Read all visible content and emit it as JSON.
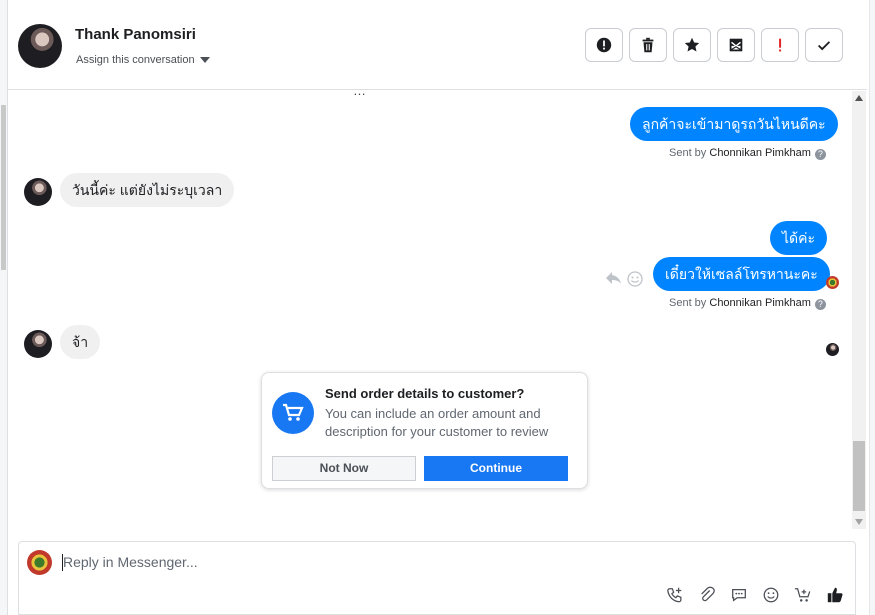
{
  "header": {
    "contact_name": "Thank Panomsiri",
    "assign_label": "Assign this conversation",
    "actions": [
      {
        "name": "mark-spam-button",
        "icon": "alert-circle-icon"
      },
      {
        "name": "delete-button",
        "icon": "trash-icon"
      },
      {
        "name": "star-button",
        "icon": "star-icon"
      },
      {
        "name": "mark-unread-button",
        "icon": "envelope-icon"
      },
      {
        "name": "follow-up-button",
        "icon": "exclamation-icon"
      },
      {
        "name": "mark-done-button",
        "icon": "checkmark-icon"
      }
    ]
  },
  "messages": [
    {
      "direction": "out",
      "text": "ลูกค้าจะเข้ามาดูรถวันไหนดีคะ",
      "sent_by_prefix": "Sent by",
      "sent_by_name": "Chonnikan Pimkham"
    },
    {
      "direction": "in",
      "text": "วันนี้ค่ะ แต่ยังไม่ระบุเวลา"
    },
    {
      "direction": "out",
      "text": "ได้ค่ะ"
    },
    {
      "direction": "out",
      "text": "เดี๋ยวให้เซลล์โทรหานะคะ",
      "sent_by_prefix": "Sent by",
      "sent_by_name": "Chonnikan Pimkham"
    },
    {
      "direction": "in",
      "text": "จ้า"
    }
  ],
  "order_prompt": {
    "title": "Send order details to customer?",
    "description": "You can include an order amount and description for your customer to review",
    "not_now_label": "Not Now",
    "continue_label": "Continue"
  },
  "reply": {
    "placeholder": "Reply in Messenger...",
    "tools": [
      "phone-add-icon",
      "paperclip-icon",
      "saved-reply-icon",
      "emoji-icon",
      "cart-add-icon",
      "thumbs-up-icon"
    ]
  },
  "colors": {
    "accent": "#1877f2",
    "outgoing_bubble": "#0084ff",
    "incoming_bubble": "#f1f0f0"
  }
}
